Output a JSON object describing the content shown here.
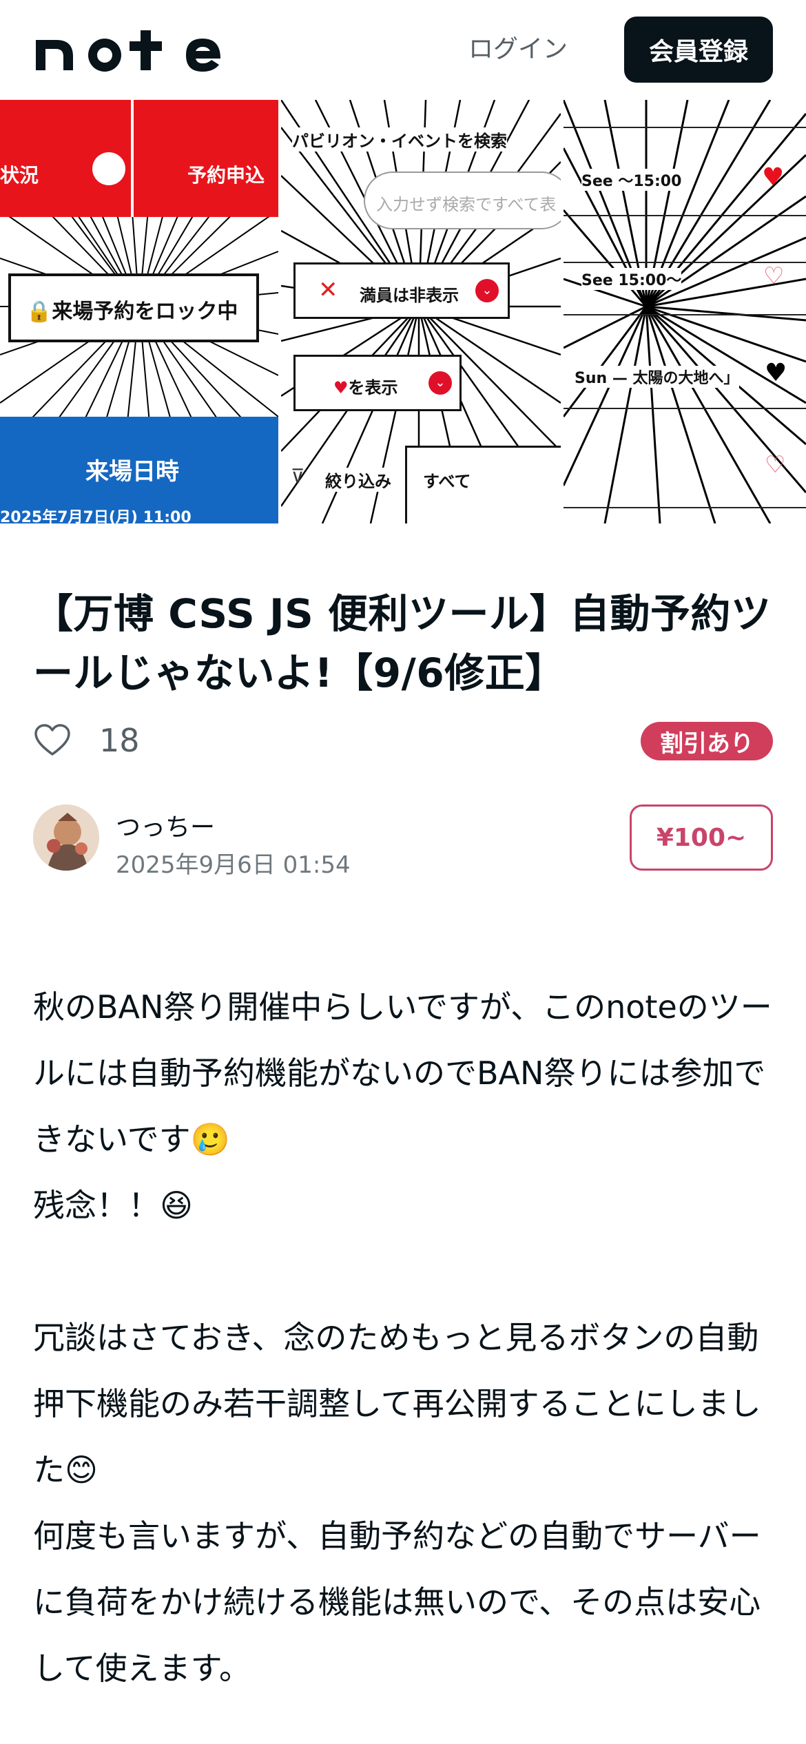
{
  "header": {
    "logo_text": "note",
    "login_label": "ログイン",
    "signup_label": "会員登録"
  },
  "banner": {
    "panel1": {
      "top_left_text": "状況",
      "top_right_text": "予約申込",
      "lock_text": "🔒来場予約をロック中",
      "bottom_text": "来場日時",
      "bottom_partial_text": "2025年7月7日(月) 11:00"
    },
    "panel2": {
      "search_title": "パビリオン・イベントを検索",
      "search_placeholder": "入力せず検索ですべて表",
      "hide_full_text": "満員は非表示",
      "show_heart_text": "♥を表示",
      "filter_text": "絞り込み",
      "all_text": "すべて"
    },
    "panel3": {
      "row1": "See 〜15:00",
      "row2": "See 15:00〜",
      "row3": "Sun — 太陽の大地へ」"
    }
  },
  "article": {
    "title": "【万博 CSS JS 便利ツール】自動予約ツールじゃないよ!【9/6修正】",
    "like_count": "18",
    "discount_badge": "割引あり",
    "author_name": "つっちー",
    "published_at": "2025年9月6日 01:54",
    "price": "¥100~",
    "paragraphs": [
      "秋のBAN祭り開催中らしいですが、このnoteのツールには自動予約機能がないのでBAN祭りには参加できないです🥲",
      "残念！！😆",
      "",
      "冗談はさておき、念のためもっと見るボタンの自動押下機能のみ若干調整して再公開することにしました😊",
      "何度も言いますが、自動予約などの自動でサーバーに負荷をかけ続ける機能は無いので、その点は安心して使えます。"
    ]
  },
  "colors": {
    "primary_dark": "#08131a",
    "discount_red": "#d13e5c",
    "price_border": "#c9446a",
    "banner_red": "#e8141c",
    "banner_blue": "#1568c2"
  }
}
